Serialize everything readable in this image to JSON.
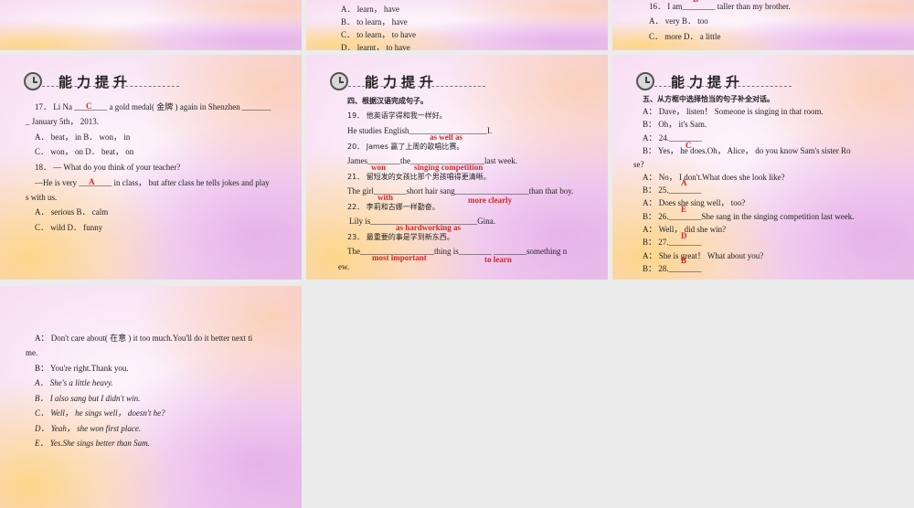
{
  "header_title": "能力提升",
  "s1": {
    "l1": "A． learn， have",
    "l2": "B． to learn， have",
    "l3": "C． to learn， to have",
    "l4": "D． learnt， to have"
  },
  "s2": {
    "ans16": "D",
    "l1": "16． I am________ taller than my brother.",
    "l2": "A． very  B． too",
    "l3": "C． more  D． a little"
  },
  "s3": {
    "l1": "17． Li Na ________ a gold medal( 金牌 ) again in Shenzhen _______",
    "ans17": "C",
    "l2": "_ January 5th， 2013.",
    "l3": "A． beat， in  B． won， in",
    "l4": "C． won， on  D． beat， on",
    "l5": "18． — What do you think of your teacher?",
    "l6": "—He is very ________ in class， but after class he tells jokes and play",
    "ans18": "A",
    "l7": "s with us.",
    "l8": "A． serious  B． calm",
    "l9": "C． wild  D． funny"
  },
  "s4": {
    "l1": "四、根据汉语完成句子。",
    "l2": "19． 他英语学得和我一样好。",
    "l3": "He studies English___________________I.",
    "a19": "as well as",
    "l4": "20． James 赢了上周的歌唱比赛。",
    "l5": "James________the__________________last week.",
    "a20a": "won",
    "a20b": "singing competition",
    "l6": "21． 留短发的女孩比那个男孩唱得更清晰。",
    "l7": "The girl________short hair sang__________________than that boy.",
    "a21a": "with",
    "a21b": "more clearly",
    "l8": "22． 李莉和古娜一样勤奋。",
    "l9": "Lily is__________________________Gina.",
    "a22": "as hardworking as",
    "l10": "23． 最重要的事是学到新东西。",
    "l11": "The__________________thing is________ ________something n",
    "a23a": "most important",
    "a23b": "to learn",
    "l12": "ew."
  },
  "s5": {
    "l1": "五、从方框中选择恰当的句子补全对话。",
    "l2": "A： Dave， listen！ Someone is singing in that room.",
    "l3": "B： Oh， it's Sam.",
    "l4": "A： 24.________",
    "a24": "C",
    "l5": "B： Yes， he does.Oh， Alice， do you know Sam's sister Ro",
    "l6": "se?",
    "l7": "A： No， I don't.What does she look like?",
    "l8": "B： 25.________",
    "a25": "A",
    "l9": "A： Does she sing well， too?",
    "l10": "B： 26.________She sang in the singing competition last week.",
    "a26": "E",
    "l11": "A： Well， did she win?",
    "l12": "B： 27.________",
    "a27": "D",
    "l13": "A： She is great！ What about you?",
    "l14": "B： 28.________",
    "a28": "B"
  },
  "s6": {
    "l1": "A： Don't care about( 在意 ) it too much.You'll do it better next ti",
    "l2": "me.",
    "l3": "B： You're right.Thank you.",
    "l4": "A． She's a little heavy.",
    "l5": "B． I also sang but I didn't win.",
    "l6": "C． Well， he sings well， doesn't he?",
    "l7": "D． Yeah， she won first place.",
    "l8": "E． Yes.She sings better than Sam."
  }
}
